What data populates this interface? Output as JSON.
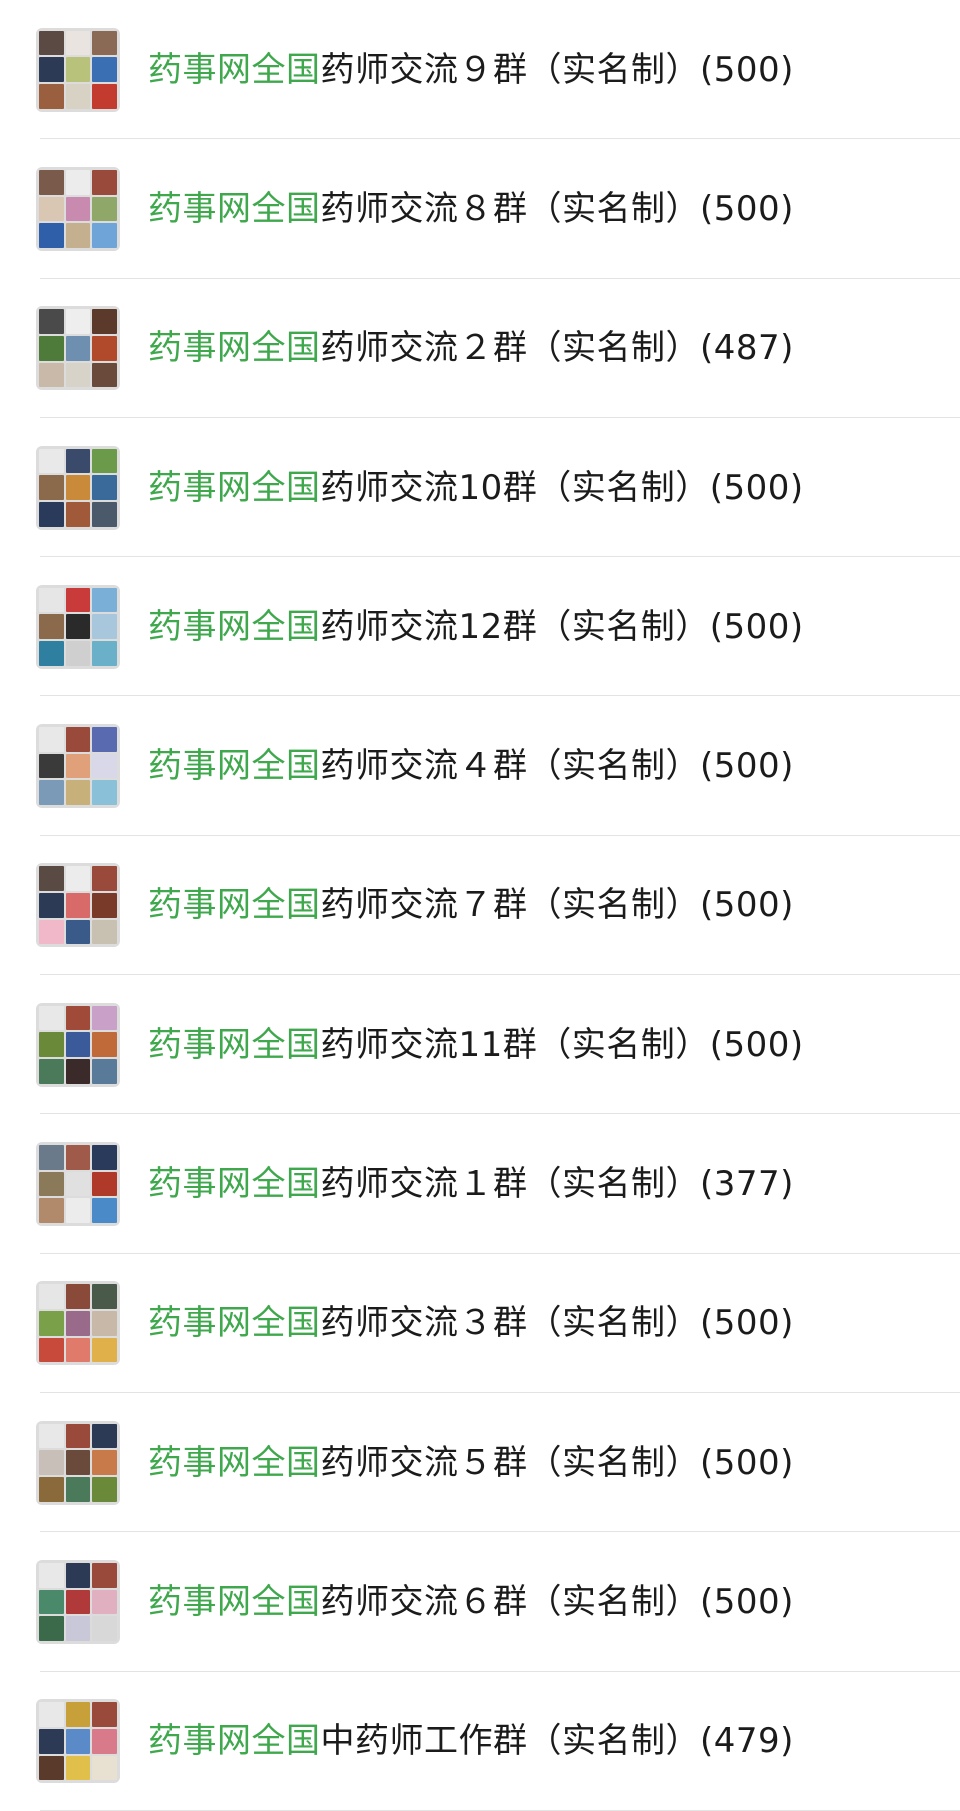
{
  "chat_list": {
    "items": [
      {
        "prefix": "药事网全国",
        "suffix": "药师交流９群（实名制）(500)",
        "avatar": "group-avatar"
      },
      {
        "prefix": "药事网全国",
        "suffix": "药师交流８群（实名制）(500)",
        "avatar": "group-avatar"
      },
      {
        "prefix": "药事网全国",
        "suffix": "药师交流２群（实名制）(487)",
        "avatar": "group-avatar"
      },
      {
        "prefix": "药事网全国",
        "suffix": "药师交流10群（实名制）(500)",
        "avatar": "group-avatar"
      },
      {
        "prefix": "药事网全国",
        "suffix": "药师交流12群（实名制）(500)",
        "avatar": "group-avatar"
      },
      {
        "prefix": "药事网全国",
        "suffix": "药师交流４群（实名制）(500)",
        "avatar": "group-avatar"
      },
      {
        "prefix": "药事网全国",
        "suffix": "药师交流７群（实名制）(500)",
        "avatar": "group-avatar"
      },
      {
        "prefix": "药事网全国",
        "suffix": "药师交流11群（实名制）(500)",
        "avatar": "group-avatar"
      },
      {
        "prefix": "药事网全国",
        "suffix": "药师交流１群（实名制）(377)",
        "avatar": "group-avatar"
      },
      {
        "prefix": "药事网全国",
        "suffix": "药师交流３群（实名制）(500)",
        "avatar": "group-avatar"
      },
      {
        "prefix": "药事网全国",
        "suffix": "药师交流５群（实名制）(500)",
        "avatar": "group-avatar"
      },
      {
        "prefix": "药事网全国",
        "suffix": "药师交流６群（实名制）(500)",
        "avatar": "group-avatar"
      },
      {
        "prefix": "药事网全国",
        "suffix": "中药师工作群（实名制）(479)",
        "avatar": "group-avatar"
      }
    ]
  },
  "colors": {
    "highlight": "#3fa84d",
    "text": "#1b1b1b",
    "divider": "#e3e3e3"
  }
}
